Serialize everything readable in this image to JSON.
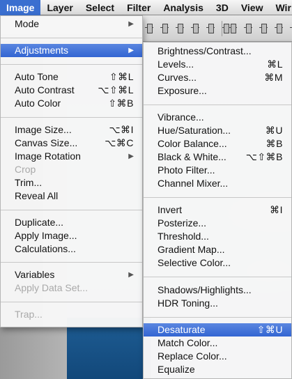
{
  "menubar": [
    "Image",
    "Layer",
    "Select",
    "Filter",
    "Analysis",
    "3D",
    "View",
    "Wir"
  ],
  "image_menu": {
    "groups": [
      [
        {
          "label": "Mode",
          "submenu": true
        }
      ],
      [
        {
          "label": "Adjustments",
          "submenu": true,
          "highlighted": true
        }
      ],
      [
        {
          "label": "Auto Tone",
          "shortcut": "⇧⌘L"
        },
        {
          "label": "Auto Contrast",
          "shortcut": "⌥⇧⌘L"
        },
        {
          "label": "Auto Color",
          "shortcut": "⇧⌘B"
        }
      ],
      [
        {
          "label": "Image Size...",
          "shortcut": "⌥⌘I"
        },
        {
          "label": "Canvas Size...",
          "shortcut": "⌥⌘C"
        },
        {
          "label": "Image Rotation",
          "submenu": true
        },
        {
          "label": "Crop",
          "disabled": true
        },
        {
          "label": "Trim..."
        },
        {
          "label": "Reveal All"
        }
      ],
      [
        {
          "label": "Duplicate..."
        },
        {
          "label": "Apply Image..."
        },
        {
          "label": "Calculations..."
        }
      ],
      [
        {
          "label": "Variables",
          "submenu": true
        },
        {
          "label": "Apply Data Set...",
          "disabled": true
        }
      ],
      [
        {
          "label": "Trap...",
          "disabled": true
        }
      ]
    ]
  },
  "adjustments_menu": {
    "groups": [
      [
        {
          "label": "Brightness/Contrast..."
        },
        {
          "label": "Levels...",
          "shortcut": "⌘L"
        },
        {
          "label": "Curves...",
          "shortcut": "⌘M"
        },
        {
          "label": "Exposure..."
        }
      ],
      [
        {
          "label": "Vibrance..."
        },
        {
          "label": "Hue/Saturation...",
          "shortcut": "⌘U"
        },
        {
          "label": "Color Balance...",
          "shortcut": "⌘B"
        },
        {
          "label": "Black & White...",
          "shortcut": "⌥⇧⌘B"
        },
        {
          "label": "Photo Filter..."
        },
        {
          "label": "Channel Mixer..."
        }
      ],
      [
        {
          "label": "Invert",
          "shortcut": "⌘I"
        },
        {
          "label": "Posterize..."
        },
        {
          "label": "Threshold..."
        },
        {
          "label": "Gradient Map..."
        },
        {
          "label": "Selective Color..."
        }
      ],
      [
        {
          "label": "Shadows/Highlights..."
        },
        {
          "label": "HDR Toning..."
        }
      ],
      [
        {
          "label": "Desaturate",
          "shortcut": "⇧⌘U",
          "highlighted": true
        },
        {
          "label": "Match Color..."
        },
        {
          "label": "Replace Color..."
        },
        {
          "label": "Equalize"
        }
      ]
    ]
  },
  "colors": {
    "highlight": "#3365d2",
    "disabled_text": "#a9a9a9"
  }
}
